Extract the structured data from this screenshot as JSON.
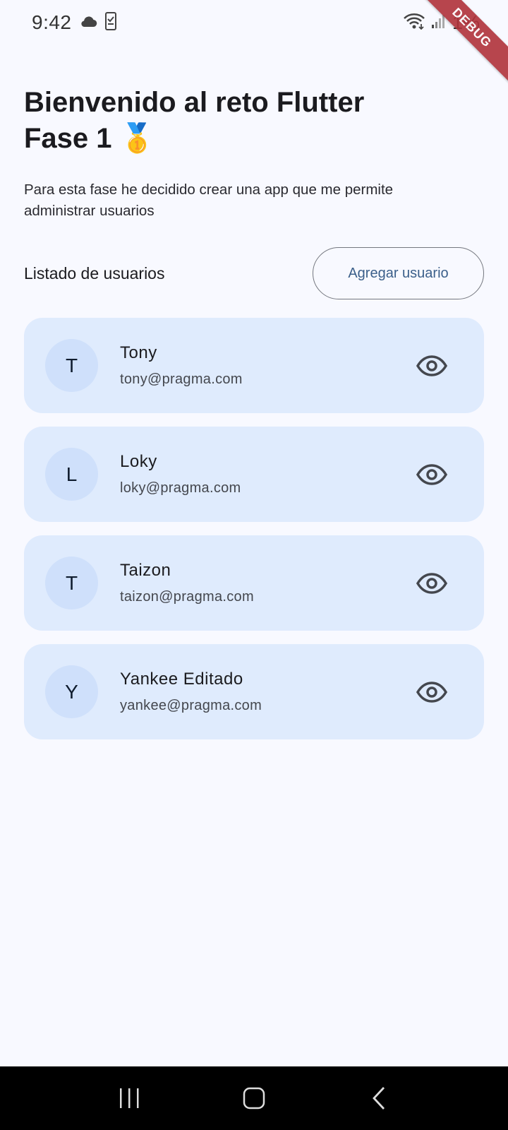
{
  "status_bar": {
    "time": "9:42",
    "battery": "1%",
    "icons": [
      "cloud-icon",
      "phone-check-icon",
      "wifi-icon",
      "signal-icon"
    ]
  },
  "debug_banner": "DEBUG",
  "header": {
    "title": "Bienvenido al reto Flutter Fase 1 🥇",
    "subtitle": "Para esta fase he decidido crear una app que me permite administrar usuarios"
  },
  "users_section": {
    "title": "Listado de usuarios",
    "add_button_label": "Agregar usuario"
  },
  "users": [
    {
      "initial": "T",
      "name": "Tony",
      "email": "tony@pragma.com"
    },
    {
      "initial": "L",
      "name": "Loky",
      "email": "loky@pragma.com"
    },
    {
      "initial": "T",
      "name": "Taizon",
      "email": "taizon@pragma.com"
    },
    {
      "initial": "Y",
      "name": "Yankee Editado",
      "email": "yankee@pragma.com"
    }
  ],
  "colors": {
    "background": "#f8f9ff",
    "card": "#dfebfd",
    "avatar": "#cfe0fb",
    "button_text": "#3b5f8a",
    "debug_ribbon": "#b0323a"
  },
  "nav_bar": {
    "icons": [
      "recent-apps-icon",
      "home-icon",
      "back-icon"
    ]
  }
}
